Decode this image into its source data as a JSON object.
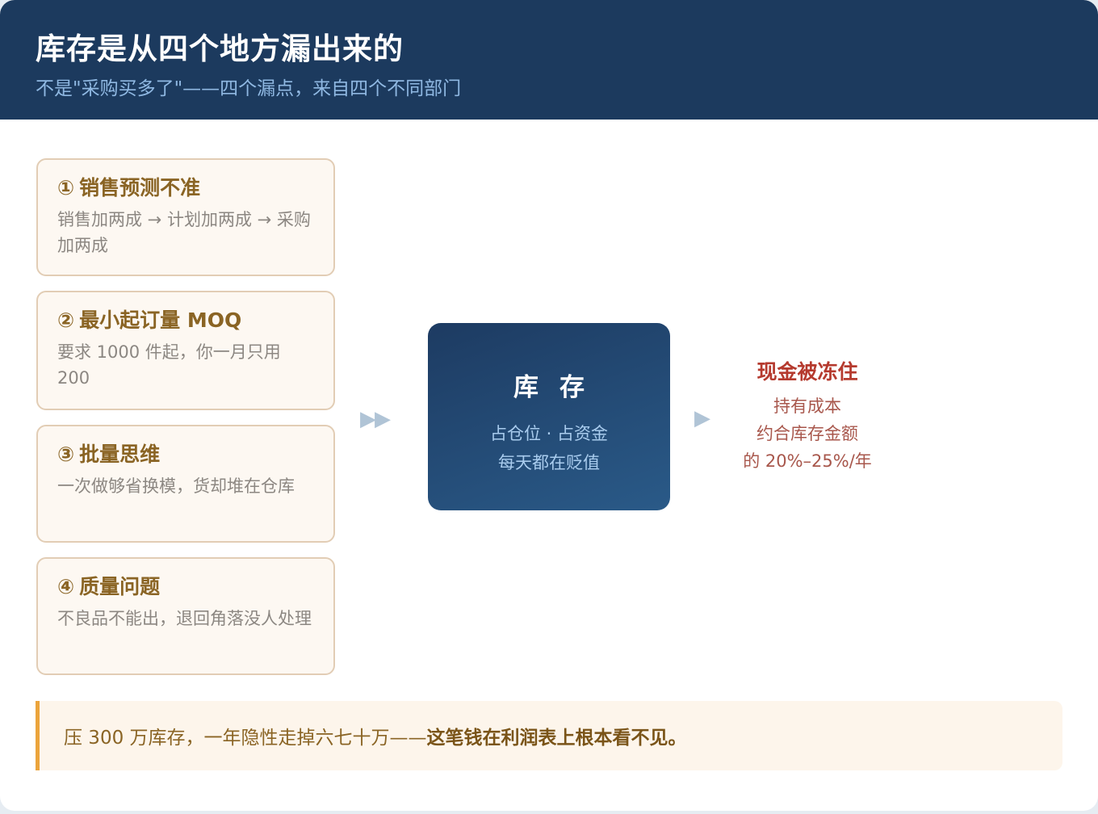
{
  "header": {
    "title": "库存是从四个地方漏出来的",
    "subtitle": "不是\"采购买多了\"——四个漏点，来自四个不同部门"
  },
  "leaks": [
    {
      "num": "①",
      "title": "销售预测不准",
      "desc": "销售加两成 → 计划加两成 → 采购加两成"
    },
    {
      "num": "②",
      "title": "最小起订量 MOQ",
      "desc": "要求 1000 件起，你一月只用 200"
    },
    {
      "num": "③",
      "title": "批量思维",
      "desc": "一次做够省换模，货却堆在仓库"
    },
    {
      "num": "④",
      "title": "质量问题",
      "desc": "不良品不能出，退回角落没人处理"
    }
  ],
  "flow": {
    "double_arrow": "▶▶",
    "single_arrow": "▶"
  },
  "core": {
    "title": "库存",
    "line1": "占仓位 · 占资金",
    "line2": "每天都在贬值"
  },
  "result": {
    "title": "现金被冻住",
    "line1": "持有成本",
    "line2": "约合库存金额",
    "line3": "的 20%–25%/年"
  },
  "footer": {
    "text": "压 300 万库存，一年隐性走掉六七十万——",
    "emphasis": "这笔钱在利润表上根本看不见。"
  },
  "colors": {
    "header_bg": "#1c3a5e",
    "accent_gold": "#8a6424",
    "result_red": "#b53a2e",
    "footer_bar": "#eba43c"
  }
}
